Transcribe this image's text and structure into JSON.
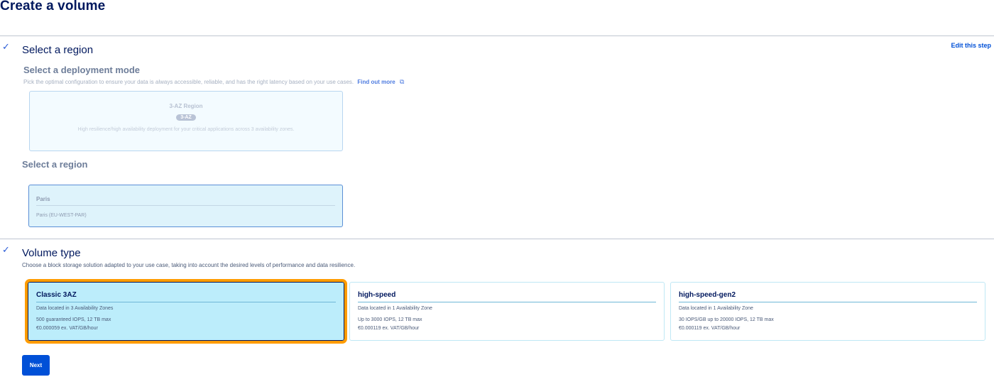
{
  "page": {
    "title": "Create a volume"
  },
  "step_region": {
    "title": "Select a region",
    "edit_label": "Edit this step",
    "deployment": {
      "heading": "Select a deployment mode",
      "description": "Pick the optimal configuration to ensure your data is always accessible, reliable, and has the right latency based on your use cases.",
      "link_label": "Find out more",
      "card": {
        "name": "3-AZ Region",
        "badge": "3-AZ",
        "description": "High resilience/high availability deployment for your critical applications across 3 availability zones."
      }
    },
    "region": {
      "heading": "Select a region",
      "card": {
        "city": "Paris",
        "code": "Paris (EU-WEST-PAR)"
      }
    }
  },
  "step_volume": {
    "title": "Volume type",
    "description": "Choose a block storage solution adapted to your use case, taking into account the desired levels of performance and data resilience.",
    "cards": [
      {
        "name": "Classic 3AZ",
        "location": "Data located in 3 Availability Zones",
        "performance": "500 guaranteed IOPS, 12 TB max",
        "price": "€0.000059 ex. VAT/GB/hour",
        "selected": true
      },
      {
        "name": "high-speed",
        "location": "Data located in 1 Availability Zone",
        "performance": "Up to 3000 IOPS, 12 TB max",
        "price": "€0.000119 ex. VAT/GB/hour",
        "selected": false
      },
      {
        "name": "high-speed-gen2",
        "location": "Data located in 1 Availability Zone",
        "performance": "30 IOPS/GB up to 20000 IOPS, 12 TB max",
        "price": "€0.000119 ex. VAT/GB/hour",
        "selected": false
      }
    ],
    "next_label": "Next"
  },
  "icons": {
    "check": "checkmark-icon",
    "external": "external-link-icon"
  },
  "colors": {
    "primary": "#0050d7",
    "title": "#00185e",
    "selected_outline": "#ff9c00",
    "selected_bg": "#bcedfb"
  }
}
